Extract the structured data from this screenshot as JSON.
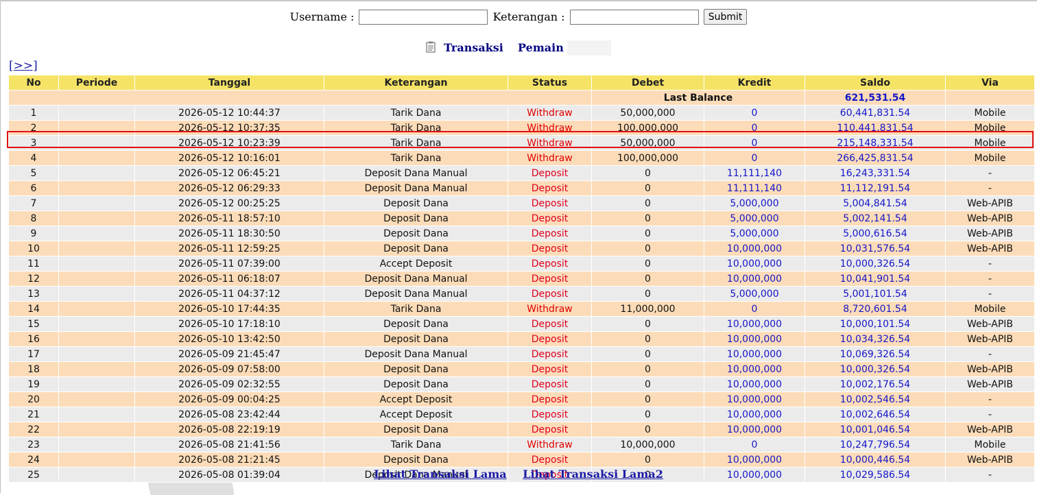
{
  "form": {
    "username_label": "Username :",
    "username_value": "",
    "keterangan_label": "Keterangan :",
    "keterangan_value": "",
    "submit_label": "Submit"
  },
  "title": {
    "transaksi": "Transaksi",
    "pemain": "Pemain"
  },
  "nav": {
    "next_label": "[>>]"
  },
  "table": {
    "headers": [
      "No",
      "Periode",
      "Tanggal",
      "Keterangan",
      "Status",
      "Debet",
      "Kredit",
      "Saldo",
      "Via"
    ],
    "last_balance_label": "Last Balance",
    "last_balance_value": "621,531.54",
    "rows": [
      {
        "no": "1",
        "periode": "",
        "tanggal": "2026-05-12 10:44:37",
        "keterangan": "Tarik Dana",
        "status": "Withdraw",
        "debet": "50,000,000",
        "kredit": "0",
        "saldo": "60,441,831.54",
        "via": "Mobile"
      },
      {
        "no": "2",
        "periode": "",
        "tanggal": "2026-05-12 10:37:35",
        "keterangan": "Tarik Dana",
        "status": "Withdraw",
        "debet": "100,000,000",
        "kredit": "0",
        "saldo": "110,441,831.54",
        "via": "Mobile"
      },
      {
        "no": "3",
        "periode": "",
        "tanggal": "2026-05-12 10:23:39",
        "keterangan": "Tarik Dana",
        "status": "Withdraw",
        "debet": "50,000,000",
        "kredit": "0",
        "saldo": "215,148,331.54",
        "via": "Mobile"
      },
      {
        "no": "4",
        "periode": "",
        "tanggal": "2026-05-12 10:16:01",
        "keterangan": "Tarik Dana",
        "status": "Withdraw",
        "debet": "100,000,000",
        "kredit": "0",
        "saldo": "266,425,831.54",
        "via": "Mobile"
      },
      {
        "no": "5",
        "periode": "",
        "tanggal": "2026-05-12 06:45:21",
        "keterangan": "Deposit Dana Manual",
        "status": "Deposit",
        "debet": "0",
        "kredit": "11,111,140",
        "saldo": "16,243,331.54",
        "via": "-"
      },
      {
        "no": "6",
        "periode": "",
        "tanggal": "2026-05-12 06:29:33",
        "keterangan": "Deposit Dana Manual",
        "status": "Deposit",
        "debet": "0",
        "kredit": "11,111,140",
        "saldo": "11,112,191.54",
        "via": "-"
      },
      {
        "no": "7",
        "periode": "",
        "tanggal": "2026-05-12 00:25:25",
        "keterangan": "Deposit Dana",
        "status": "Deposit",
        "debet": "0",
        "kredit": "5,000,000",
        "saldo": "5,004,841.54",
        "via": "Web-APIB"
      },
      {
        "no": "8",
        "periode": "",
        "tanggal": "2026-05-11 18:57:10",
        "keterangan": "Deposit Dana",
        "status": "Deposit",
        "debet": "0",
        "kredit": "5,000,000",
        "saldo": "5,002,141.54",
        "via": "Web-APIB"
      },
      {
        "no": "9",
        "periode": "",
        "tanggal": "2026-05-11 18:30:50",
        "keterangan": "Deposit Dana",
        "status": "Deposit",
        "debet": "0",
        "kredit": "5,000,000",
        "saldo": "5,000,616.54",
        "via": "Web-APIB"
      },
      {
        "no": "10",
        "periode": "",
        "tanggal": "2026-05-11 12:59:25",
        "keterangan": "Deposit Dana",
        "status": "Deposit",
        "debet": "0",
        "kredit": "10,000,000",
        "saldo": "10,031,576.54",
        "via": "Web-APIB"
      },
      {
        "no": "11",
        "periode": "",
        "tanggal": "2026-05-11 07:39:00",
        "keterangan": "Accept Deposit",
        "status": "Deposit",
        "debet": "0",
        "kredit": "10,000,000",
        "saldo": "10,000,326.54",
        "via": "-"
      },
      {
        "no": "12",
        "periode": "",
        "tanggal": "2026-05-11 06:18:07",
        "keterangan": "Deposit Dana Manual",
        "status": "Deposit",
        "debet": "0",
        "kredit": "10,000,000",
        "saldo": "10,041,901.54",
        "via": "-"
      },
      {
        "no": "13",
        "periode": "",
        "tanggal": "2026-05-11 04:37:12",
        "keterangan": "Deposit Dana Manual",
        "status": "Deposit",
        "debet": "0",
        "kredit": "5,000,000",
        "saldo": "5,001,101.54",
        "via": "-"
      },
      {
        "no": "14",
        "periode": "",
        "tanggal": "2026-05-10 17:44:35",
        "keterangan": "Tarik Dana",
        "status": "Withdraw",
        "debet": "11,000,000",
        "kredit": "0",
        "saldo": "8,720,601.54",
        "via": "Mobile"
      },
      {
        "no": "15",
        "periode": "",
        "tanggal": "2026-05-10 17:18:10",
        "keterangan": "Deposit Dana",
        "status": "Deposit",
        "debet": "0",
        "kredit": "10,000,000",
        "saldo": "10,000,101.54",
        "via": "Web-APIB"
      },
      {
        "no": "16",
        "periode": "",
        "tanggal": "2026-05-10 13:42:50",
        "keterangan": "Deposit Dana",
        "status": "Deposit",
        "debet": "0",
        "kredit": "10,000,000",
        "saldo": "10,034,326.54",
        "via": "Web-APIB"
      },
      {
        "no": "17",
        "periode": "",
        "tanggal": "2026-05-09 21:45:47",
        "keterangan": "Deposit Dana Manual",
        "status": "Deposit",
        "debet": "0",
        "kredit": "10,000,000",
        "saldo": "10,069,326.54",
        "via": "-"
      },
      {
        "no": "18",
        "periode": "",
        "tanggal": "2026-05-09 07:58:00",
        "keterangan": "Deposit Dana",
        "status": "Deposit",
        "debet": "0",
        "kredit": "10,000,000",
        "saldo": "10,000,326.54",
        "via": "Web-APIB"
      },
      {
        "no": "19",
        "periode": "",
        "tanggal": "2026-05-09 02:32:55",
        "keterangan": "Deposit Dana",
        "status": "Deposit",
        "debet": "0",
        "kredit": "10,000,000",
        "saldo": "10,002,176.54",
        "via": "Web-APIB"
      },
      {
        "no": "20",
        "periode": "",
        "tanggal": "2026-05-09 00:04:25",
        "keterangan": "Accept Deposit",
        "status": "Deposit",
        "debet": "0",
        "kredit": "10,000,000",
        "saldo": "10,002,546.54",
        "via": "-"
      },
      {
        "no": "21",
        "periode": "",
        "tanggal": "2026-05-08 23:42:44",
        "keterangan": "Accept Deposit",
        "status": "Deposit",
        "debet": "0",
        "kredit": "10,000,000",
        "saldo": "10,002,646.54",
        "via": "-"
      },
      {
        "no": "22",
        "periode": "",
        "tanggal": "2026-05-08 22:19:19",
        "keterangan": "Deposit Dana",
        "status": "Deposit",
        "debet": "0",
        "kredit": "10,000,000",
        "saldo": "10,001,046.54",
        "via": "Web-APIB"
      },
      {
        "no": "23",
        "periode": "",
        "tanggal": "2026-05-08 21:41:56",
        "keterangan": "Tarik Dana",
        "status": "Withdraw",
        "debet": "10,000,000",
        "kredit": "0",
        "saldo": "10,247,796.54",
        "via": "Mobile"
      },
      {
        "no": "24",
        "periode": "",
        "tanggal": "2026-05-08 21:21:45",
        "keterangan": "Deposit Dana",
        "status": "Deposit",
        "debet": "0",
        "kredit": "10,000,000",
        "saldo": "10,000,446.54",
        "via": "Web-APIB"
      },
      {
        "no": "25",
        "periode": "",
        "tanggal": "2026-05-08 01:39:04",
        "keterangan": "Deposit Dana Manual",
        "status": "Deposit",
        "debet": "0",
        "kredit": "10,000,000",
        "saldo": "10,029,586.54",
        "via": "-"
      }
    ]
  },
  "footer": {
    "link1": "Lihat Transaksi Lama",
    "link2": "Lihat Transaksi Lama2"
  },
  "colors": {
    "header_bg": "#f5e366",
    "row_odd": "#ebebeb",
    "row_even": "#fcdcb8",
    "withdraw": "#e00000",
    "deposit": "#e0001a",
    "link": "#1a1aa6",
    "highlight": "#e01010"
  }
}
